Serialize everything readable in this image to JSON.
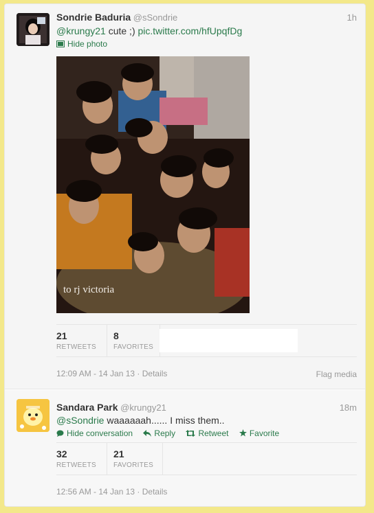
{
  "tweets": [
    {
      "fullname": "Sondrie Baduria",
      "username": "@sSondrie",
      "time": "1h",
      "mention": "@krungy21",
      "text": " cute ;) ",
      "link": "pic.twitter.com/hfUpqfDg",
      "hide_photo": "Hide photo",
      "photo_caption": "to rj victoria",
      "retweets": "21",
      "retweets_label": "RETWEETS",
      "favorites": "8",
      "favorites_label": "FAVORITES",
      "timestamp": "12:09 AM - 14 Jan 13 · Details",
      "flag": "Flag media"
    },
    {
      "fullname": "Sandara Park",
      "username": "@krungy21",
      "time": "18m",
      "mention": "@sSondrie",
      "text": " waaaaaah...... I miss them..",
      "hide_conversation": "Hide conversation",
      "reply": "Reply",
      "retweet": "Retweet",
      "favorite": "Favorite",
      "retweets": "32",
      "retweets_label": "RETWEETS",
      "favorites": "21",
      "favorites_label": "FAVORITES",
      "timestamp": "12:56 AM - 14 Jan 13 · Details"
    }
  ],
  "colors": {
    "link": "#2a7a4b",
    "page_bg": "#f3e88a"
  },
  "icons": [
    "photo-icon",
    "speech-bubble-icon",
    "reply-arrow-icon",
    "retweet-icon",
    "star-icon"
  ]
}
